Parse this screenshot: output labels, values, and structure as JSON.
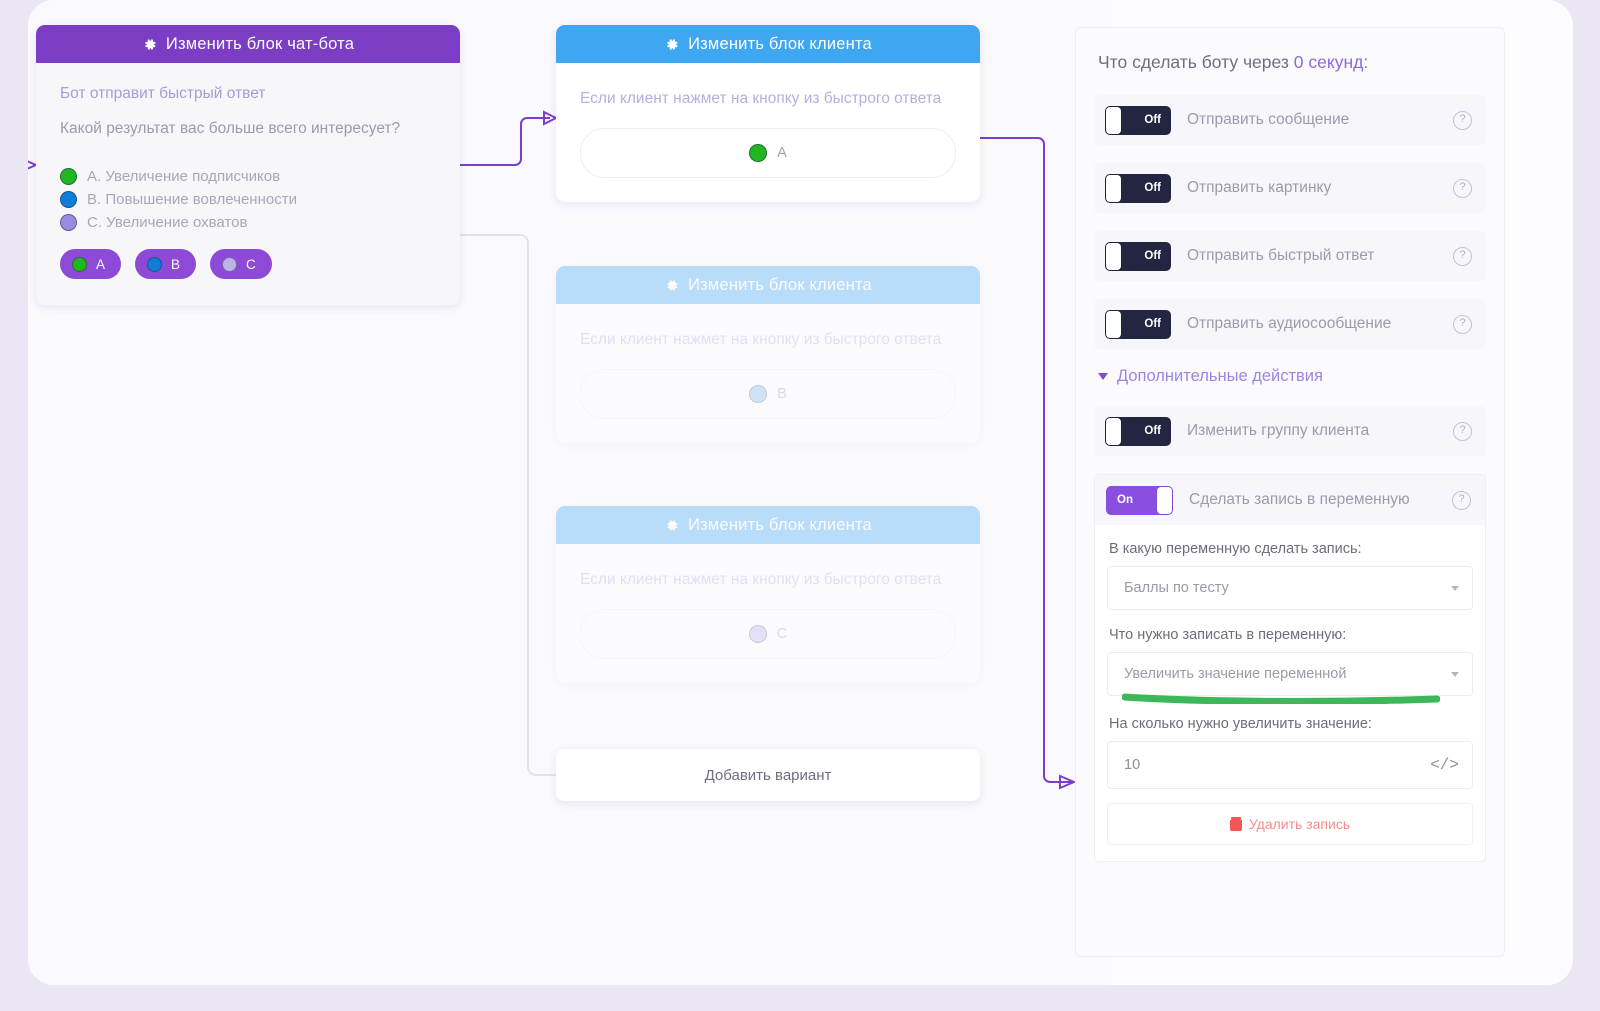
{
  "canvas": {
    "bot_block": {
      "header": "Изменить блок чат-бота",
      "header_icon": "gear-icon",
      "hint": "Бот отправит быстрый ответ",
      "question": "Какой результат вас больше всего интересует?",
      "options": [
        {
          "letter": "A",
          "label": "A. Увеличение подписчиков",
          "color": "#1fb81f"
        },
        {
          "letter": "B",
          "label": "B. Повышение вовлеченности",
          "color": "#0e7ed6"
        },
        {
          "letter": "C",
          "label": "C. Увеличение охватов",
          "color": "#9a8be2"
        }
      ]
    },
    "client_blocks": [
      {
        "header": "Изменить блок клиента",
        "header_icon": "gear-icon",
        "text": "Если клиент нажмет на кнопку из быстрого ответа",
        "answer_letter": "A",
        "answer_color": "#1fb81f"
      },
      {
        "header": "Изменить блок клиента",
        "header_icon": "gear-icon",
        "text": "Если клиент нажмет на кнопку из быстрого ответа",
        "answer_letter": "B",
        "answer_color": "#7fbbe8"
      },
      {
        "header": "Изменить блок клиента",
        "header_icon": "gear-icon",
        "text": "Если клиент нажмет на кнопку из быстрого ответа",
        "answer_letter": "C",
        "answer_color": "#bdb3e8"
      }
    ],
    "add_variant_label": "Добавить вариант",
    "connector_color": "#7b3ecc"
  },
  "panel": {
    "title_prefix": "Что сделать боту через ",
    "title_value": "0 секунд:",
    "actions": [
      {
        "toggle": "Off",
        "state": "off",
        "label": "Отправить сообщение",
        "help_icon": "help-circle-icon"
      },
      {
        "toggle": "Off",
        "state": "off",
        "label": "Отправить картинку",
        "help_icon": "help-circle-icon"
      },
      {
        "toggle": "Off",
        "state": "off",
        "label": "Отправить быстрый ответ",
        "help_icon": "help-circle-icon"
      },
      {
        "toggle": "Off",
        "state": "off",
        "label": "Отправить аудиосообщение",
        "help_icon": "help-circle-icon"
      }
    ],
    "extra_section": {
      "caret_icon": "chevron-down-icon",
      "label": "Дополнительные действия"
    },
    "extra_actions": [
      {
        "toggle": "Off",
        "state": "off",
        "label": "Изменить группу клиента",
        "help_icon": "help-circle-icon"
      }
    ],
    "variable_block": {
      "toggle": "On",
      "state": "on",
      "label": "Сделать запись в переменную",
      "help_icon": "help-circle-icon",
      "variable_label": "В какую переменную сделать запись:",
      "variable_value": "Баллы по тесту",
      "write_label": "Что нужно записать в переменную:",
      "write_value": "Увеличить значение переменной",
      "amount_label": "На сколько нужно увеличить значение:",
      "amount_value": "10",
      "code_icon": "code-icon",
      "delete_label": "Удалить запись",
      "delete_icon": "trash-icon"
    },
    "annotation_color": "#3cb75a"
  }
}
